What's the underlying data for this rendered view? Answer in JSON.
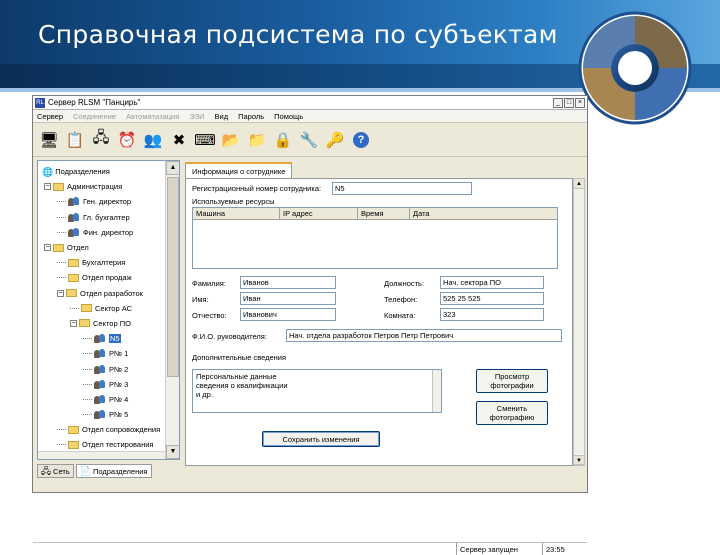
{
  "slide": {
    "title": "Справочная подсистема по субъектам"
  },
  "window": {
    "title": "Сервер RLSM \"Панцирь\"",
    "app_icon": "RL",
    "controls": {
      "minimize": "_",
      "maximize": "□",
      "close": "×"
    }
  },
  "menu": [
    {
      "label": "Сервер",
      "enabled": true
    },
    {
      "label": "Соединение",
      "enabled": false
    },
    {
      "label": "Автоматизация",
      "enabled": false
    },
    {
      "label": "ЭЗИ",
      "enabled": false
    },
    {
      "label": "Вид",
      "enabled": true
    },
    {
      "label": "Пароль",
      "enabled": true
    },
    {
      "label": "Помощь",
      "enabled": true
    }
  ],
  "toolbar": {
    "icons": [
      "monitor-user-icon",
      "checklist-icon",
      "network-icon",
      "clock-icon",
      "users-group-icon",
      "users-delete-icon",
      "keyboard-icon",
      "folder-open-icon",
      "folder-arrow-icon",
      "lock-icon",
      "tools-icon",
      "settings-key-icon",
      "help-icon"
    ]
  },
  "tree": {
    "root": "Подразделения",
    "nodes": [
      {
        "label": "Администрация",
        "type": "folder",
        "level": 1,
        "expander": "−"
      },
      {
        "label": "Ген. директор",
        "type": "people",
        "level": 2
      },
      {
        "label": "Гл. бухгалтер",
        "type": "people",
        "level": 2
      },
      {
        "label": "Фин. директор",
        "type": "people",
        "level": 2
      },
      {
        "label": "Отдел",
        "type": "folder",
        "level": 1,
        "expander": "−"
      },
      {
        "label": "Бухгалтерия",
        "type": "folder",
        "level": 2
      },
      {
        "label": "Отдел продаж",
        "type": "folder",
        "level": 2
      },
      {
        "label": "Отдел разработок",
        "type": "folder",
        "level": 2,
        "expander": "−"
      },
      {
        "label": "Сектор АС",
        "type": "folder",
        "level": 3
      },
      {
        "label": "Сектор ПО",
        "type": "folder",
        "level": 3,
        "expander": "−"
      },
      {
        "label": "N5",
        "type": "people",
        "level": 4,
        "selected": true
      },
      {
        "label": "Р№ 1",
        "type": "people",
        "level": 4
      },
      {
        "label": "Р№ 2",
        "type": "people",
        "level": 4
      },
      {
        "label": "Р№ 3",
        "type": "people",
        "level": 4
      },
      {
        "label": "Р№ 4",
        "type": "people",
        "level": 4
      },
      {
        "label": "Р№ 5",
        "type": "people",
        "level": 4
      },
      {
        "label": "Отдел сопровождения",
        "type": "folder",
        "level": 2
      },
      {
        "label": "Отдел тестирования",
        "type": "folder",
        "level": 2
      }
    ],
    "tabs": [
      {
        "label": "Сеть",
        "active": false
      },
      {
        "label": "Подразделения",
        "active": true
      }
    ]
  },
  "details": {
    "tab_label": "Информация о сотруднике",
    "reg_no_label": "Регистрационный номер сотрудника:",
    "reg_no_value": "N5",
    "resources_label": "Используемые ресурсы",
    "grid_columns": [
      "Машина",
      "IP адрес",
      "Время",
      "Дата"
    ],
    "last_name_label": "Фамилия:",
    "last_name_value": "Иванов",
    "first_name_label": "Имя:",
    "first_name_value": "Иван",
    "patronymic_label": "Отчество:",
    "patronymic_value": "Иванович",
    "position_label": "Должность:",
    "position_value": "Нач. сектора ПО",
    "phone_label": "Телефон:",
    "phone_value": "525 25 525",
    "room_label": "Комната:",
    "room_value": "323",
    "manager_label": "Ф.И.О. руководителя:",
    "manager_value": "Нач. отдела разработок Петров Петр Петрович",
    "extra_label": "Дополнительные сведения",
    "extra_lines": [
      "Персональные данные",
      "сведения о квалификации",
      "и др."
    ],
    "btn_view_photo": "Просмотр фотографии",
    "btn_change_photo": "Сменить фотографию",
    "btn_save": "Сохранить изменения"
  },
  "statusbar": {
    "server_status": "Сервер запущен",
    "time": "23:55"
  }
}
